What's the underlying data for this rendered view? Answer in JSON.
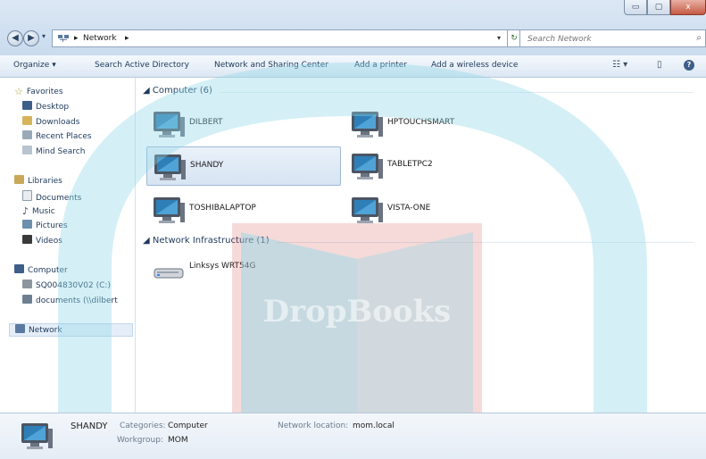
{
  "window": {
    "caption_buttons": {
      "minimize": "▭",
      "maximize": "▢",
      "close": "x"
    }
  },
  "address_bar": {
    "back_icon": "back-arrow-icon",
    "forward_icon": "forward-arrow-icon",
    "crumbs": [
      "Network"
    ],
    "refresh_glyph": "↻",
    "search_placeholder": "Search Network"
  },
  "command_bar": {
    "organize": "Organize",
    "search_ad": "Search Active Directory",
    "sharing_center": "Network and Sharing Center",
    "add_printer": "Add a printer",
    "add_wireless": "Add a wireless device",
    "help_glyph": "?"
  },
  "nav_pane": {
    "favorites": {
      "label": "Favorites",
      "items": [
        "Desktop",
        "Downloads",
        "Recent Places",
        "Mind Search"
      ]
    },
    "libraries": {
      "label": "Libraries",
      "items": [
        "Documents",
        "Music",
        "Pictures",
        "Videos"
      ]
    },
    "computer": {
      "label": "Computer",
      "items": [
        "SQ004830V02 (C:)",
        "documents (\\\\dilbert"
      ]
    },
    "network": {
      "label": "Network"
    }
  },
  "content": {
    "group_computer": "Computer (6)",
    "group_infra": "Network Infrastructure (1)",
    "computers": [
      "DILBERT",
      "HPTOUCHSMART",
      "SHANDY",
      "TABLETPC2",
      "TOSHIBALAPTOP",
      "VISTA-ONE"
    ],
    "selected": "SHANDY",
    "infra": [
      "Linksys WRT54G"
    ]
  },
  "watermark": {
    "text": "DropBooks"
  },
  "details": {
    "name": "SHANDY",
    "categories_key": "Categories:",
    "categories_val": "Computer",
    "workgroup_key": "Workgroup:",
    "workgroup_val": "MOM",
    "location_key": "Network location:",
    "location_val": "mom.local"
  },
  "colors": {
    "accent": "#1e395b",
    "selection": "#d6e4f3",
    "watermark_cyan": "#8fd8e8",
    "watermark_red": "#c8342a"
  }
}
